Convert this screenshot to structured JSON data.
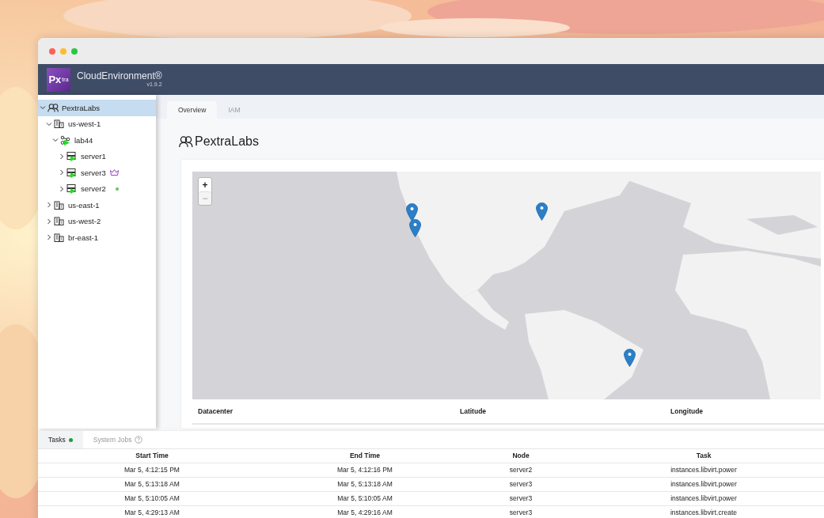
{
  "header": {
    "logo_mark": "Px",
    "logo_sub": "tra",
    "app_name": "CloudEnvironment®",
    "version": "v1.9.2"
  },
  "tree": [
    {
      "label": "PextraLabs",
      "kind": "org",
      "expanded": true,
      "selected": true,
      "children": [
        {
          "label": "us-west-1",
          "kind": "datacenter",
          "expanded": true,
          "selected": false,
          "children": [
            {
              "label": "lab44",
              "kind": "cluster",
              "expanded": true,
              "selected": false,
              "running": true,
              "children": [
                {
                  "label": "server1",
                  "kind": "server",
                  "expanded": false,
                  "selected": false,
                  "running": true,
                  "leader": false,
                  "status_dot": false
                },
                {
                  "label": "server3",
                  "kind": "server",
                  "expanded": false,
                  "selected": false,
                  "running": true,
                  "leader": true,
                  "status_dot": false
                },
                {
                  "label": "server2",
                  "kind": "server",
                  "expanded": false,
                  "selected": false,
                  "running": true,
                  "leader": false,
                  "status_dot": true
                }
              ]
            }
          ]
        },
        {
          "label": "us-east-1",
          "kind": "datacenter",
          "expanded": false,
          "selected": false
        },
        {
          "label": "us-west-2",
          "kind": "datacenter",
          "expanded": false,
          "selected": false
        },
        {
          "label": "br-east-1",
          "kind": "datacenter",
          "expanded": false,
          "selected": false
        }
      ]
    }
  ],
  "main_tabs": [
    {
      "label": "Overview",
      "selected": true
    },
    {
      "label": "IAM",
      "selected": false
    }
  ],
  "heading": "PextraLabs",
  "map": {
    "zoom_in": {
      "label": "+",
      "disabled": false
    },
    "zoom_out": {
      "label": "−",
      "disabled": true
    }
  },
  "datacenter_table": {
    "columns": [
      "Datacenter",
      "Latitude",
      "Longitude"
    ]
  },
  "bottom_tabs": [
    {
      "label": "Tasks",
      "selected": true,
      "status_dot": true,
      "help": false
    },
    {
      "label": "System Jobs",
      "selected": false,
      "status_dot": false,
      "help": true
    }
  ],
  "tasks_table": {
    "columns": [
      "Start Time",
      "End Time",
      "Node",
      "Task"
    ],
    "rows": [
      [
        "Mar 5, 4:12:15 PM",
        "Mar 5, 4:12:16 PM",
        "server2",
        "instances.libvirt.power"
      ],
      [
        "Mar 5, 5:13:18 AM",
        "Mar 5, 5:13:18 AM",
        "server3",
        "instances.libvirt.power"
      ],
      [
        "Mar 5, 5:10:05 AM",
        "Mar 5, 5:10:05 AM",
        "server3",
        "instances.libvirt.power"
      ],
      [
        "Mar 5, 4:29:13 AM",
        "Mar 5, 4:29:16 AM",
        "server3",
        "instances.libvirt.create"
      ]
    ]
  }
}
